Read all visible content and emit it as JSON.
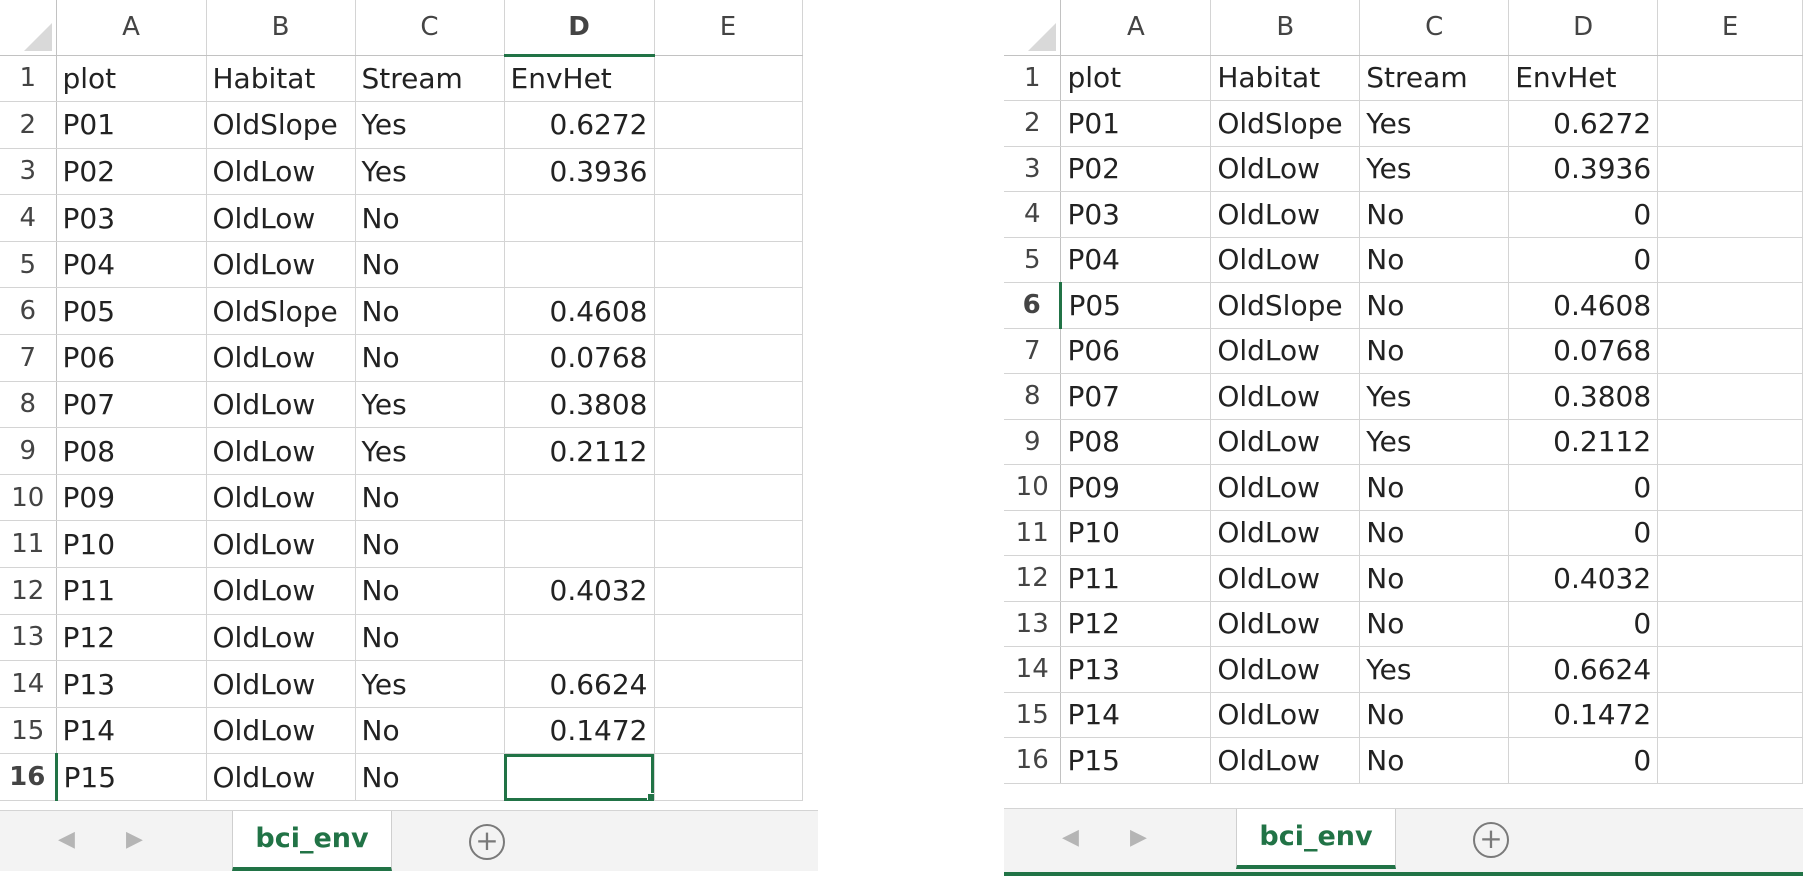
{
  "columns": [
    "A",
    "B",
    "C",
    "D",
    "E"
  ],
  "left_pane": {
    "active_column": "D",
    "active_row": "16",
    "rows": [
      {
        "num": "1",
        "cells": [
          "plot",
          "Habitat",
          "Stream",
          "EnvHet",
          ""
        ]
      },
      {
        "num": "2",
        "cells": [
          "P01",
          "OldSlope",
          "Yes",
          "0.6272",
          ""
        ]
      },
      {
        "num": "3",
        "cells": [
          "P02",
          "OldLow",
          "Yes",
          "0.3936",
          ""
        ]
      },
      {
        "num": "4",
        "cells": [
          "P03",
          "OldLow",
          "No",
          "",
          ""
        ]
      },
      {
        "num": "5",
        "cells": [
          "P04",
          "OldLow",
          "No",
          "",
          ""
        ]
      },
      {
        "num": "6",
        "cells": [
          "P05",
          "OldSlope",
          "No",
          "0.4608",
          ""
        ]
      },
      {
        "num": "7",
        "cells": [
          "P06",
          "OldLow",
          "No",
          "0.0768",
          ""
        ]
      },
      {
        "num": "8",
        "cells": [
          "P07",
          "OldLow",
          "Yes",
          "0.3808",
          ""
        ]
      },
      {
        "num": "9",
        "cells": [
          "P08",
          "OldLow",
          "Yes",
          "0.2112",
          ""
        ]
      },
      {
        "num": "10",
        "cells": [
          "P09",
          "OldLow",
          "No",
          "",
          ""
        ]
      },
      {
        "num": "11",
        "cells": [
          "P10",
          "OldLow",
          "No",
          "",
          ""
        ]
      },
      {
        "num": "12",
        "cells": [
          "P11",
          "OldLow",
          "No",
          "0.4032",
          ""
        ]
      },
      {
        "num": "13",
        "cells": [
          "P12",
          "OldLow",
          "No",
          "",
          ""
        ]
      },
      {
        "num": "14",
        "cells": [
          "P13",
          "OldLow",
          "Yes",
          "0.6624",
          ""
        ]
      },
      {
        "num": "15",
        "cells": [
          "P14",
          "OldLow",
          "No",
          "0.1472",
          ""
        ]
      },
      {
        "num": "16",
        "cells": [
          "P15",
          "OldLow",
          "No",
          "",
          ""
        ]
      }
    ],
    "sheet_tab": "bci_env"
  },
  "right_pane": {
    "active_row": "6",
    "rows": [
      {
        "num": "1",
        "cells": [
          "plot",
          "Habitat",
          "Stream",
          "EnvHet",
          ""
        ]
      },
      {
        "num": "2",
        "cells": [
          "P01",
          "OldSlope",
          "Yes",
          "0.6272",
          ""
        ]
      },
      {
        "num": "3",
        "cells": [
          "P02",
          "OldLow",
          "Yes",
          "0.3936",
          ""
        ]
      },
      {
        "num": "4",
        "cells": [
          "P03",
          "OldLow",
          "No",
          "0",
          ""
        ]
      },
      {
        "num": "5",
        "cells": [
          "P04",
          "OldLow",
          "No",
          "0",
          ""
        ]
      },
      {
        "num": "6",
        "cells": [
          "P05",
          "OldSlope",
          "No",
          "0.4608",
          ""
        ]
      },
      {
        "num": "7",
        "cells": [
          "P06",
          "OldLow",
          "No",
          "0.0768",
          ""
        ]
      },
      {
        "num": "8",
        "cells": [
          "P07",
          "OldLow",
          "Yes",
          "0.3808",
          ""
        ]
      },
      {
        "num": "9",
        "cells": [
          "P08",
          "OldLow",
          "Yes",
          "0.2112",
          ""
        ]
      },
      {
        "num": "10",
        "cells": [
          "P09",
          "OldLow",
          "No",
          "0",
          ""
        ]
      },
      {
        "num": "11",
        "cells": [
          "P10",
          "OldLow",
          "No",
          "0",
          ""
        ]
      },
      {
        "num": "12",
        "cells": [
          "P11",
          "OldLow",
          "No",
          "0.4032",
          ""
        ]
      },
      {
        "num": "13",
        "cells": [
          "P12",
          "OldLow",
          "No",
          "0",
          ""
        ]
      },
      {
        "num": "14",
        "cells": [
          "P13",
          "OldLow",
          "Yes",
          "0.6624",
          ""
        ]
      },
      {
        "num": "15",
        "cells": [
          "P14",
          "OldLow",
          "No",
          "0.1472",
          ""
        ]
      },
      {
        "num": "16",
        "cells": [
          "P15",
          "OldLow",
          "No",
          "0",
          ""
        ]
      }
    ],
    "sheet_tab": "bci_env"
  },
  "colors": {
    "accent": "#217346",
    "header_bg": "#d6d6d6",
    "gridline": "#d4d4d4"
  },
  "icons": {
    "prev": "chevron-left-icon",
    "next": "chevron-right-icon",
    "add": "plus-circle-icon"
  }
}
